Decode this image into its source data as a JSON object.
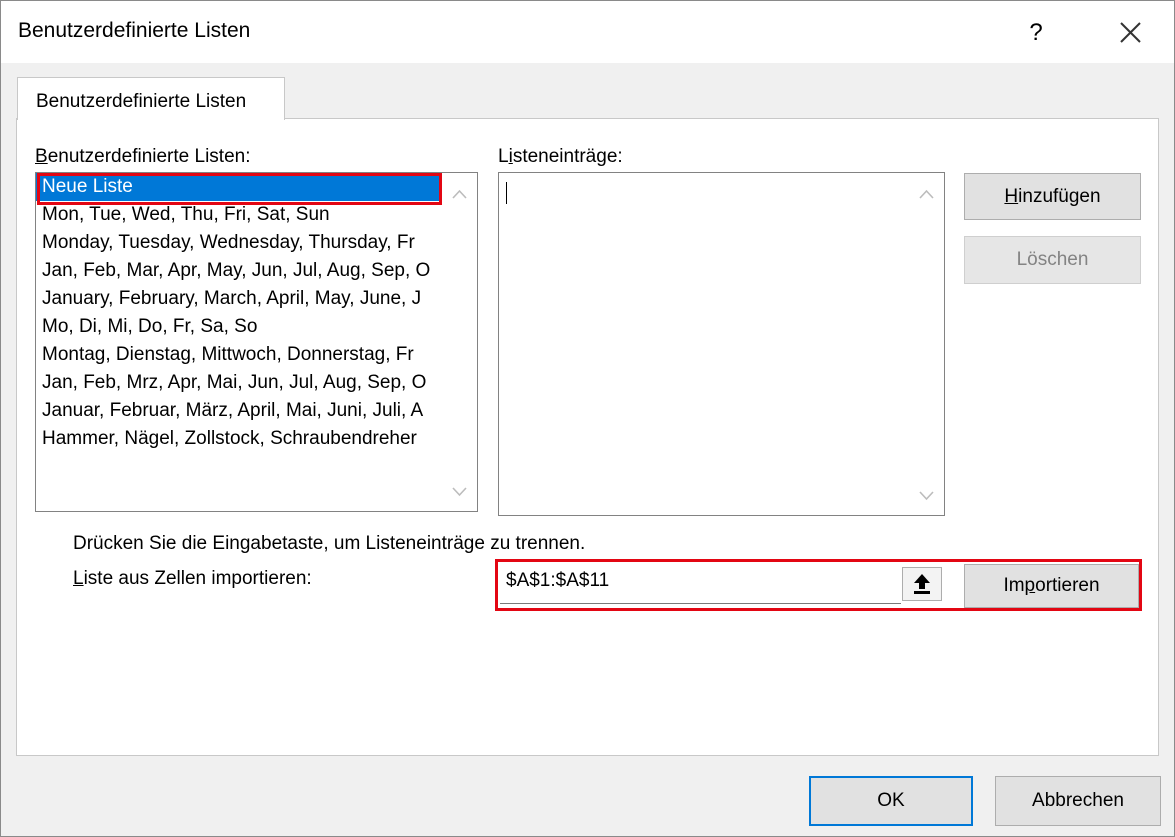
{
  "window": {
    "title": "Benutzerdefinierte Listen",
    "help_icon": "question-mark-icon",
    "close_icon": "close-icon",
    "help_label": "?"
  },
  "tabs": [
    {
      "label": "Benutzerdefinierte Listen",
      "active": true
    }
  ],
  "lists_section": {
    "label_accesskey": "B",
    "label_rest": "enutzerdefinierte Listen:",
    "items": [
      "Neue Liste",
      "Mon, Tue, Wed, Thu, Fri, Sat, Sun",
      "Monday, Tuesday, Wednesday, Thursday, Fr",
      "Jan, Feb, Mar, Apr, May, Jun, Jul, Aug, Sep, O",
      "January, February, March, April, May, June, J",
      "Mo, Di, Mi, Do, Fr, Sa, So",
      "Montag, Dienstag, Mittwoch, Donnerstag, Fr",
      "Jan, Feb, Mrz, Apr, Mai, Jun, Jul, Aug, Sep, O",
      "Januar, Februar, März, April, Mai, Juni, Juli, A",
      "Hammer, Nägel, Zollstock, Schraubendreher"
    ],
    "selected_index": 0,
    "highlight_color": "#e30613",
    "selection_color": "#0078d7"
  },
  "entries_section": {
    "label_accesskey": "L",
    "label_rest": "isteneinträge:",
    "value": ""
  },
  "buttons": {
    "add_accesskey": "H",
    "add_rest": "inzufügen",
    "delete_label": "Löschen",
    "delete_enabled": false,
    "import_pre": "Im",
    "import_accesskey": "p",
    "import_rest": "ortieren",
    "ok_label": "OK",
    "cancel_label": "Abbrechen"
  },
  "hint_text": "Drücken Sie die Eingabetaste, um Listeneinträge zu trennen.",
  "import": {
    "label_accesskey": "L",
    "label_rest": "iste aus Zellen importieren:",
    "range_value": "$A$1:$A$11",
    "collapse_icon": "collapse-dialog-arrow-up-icon"
  }
}
